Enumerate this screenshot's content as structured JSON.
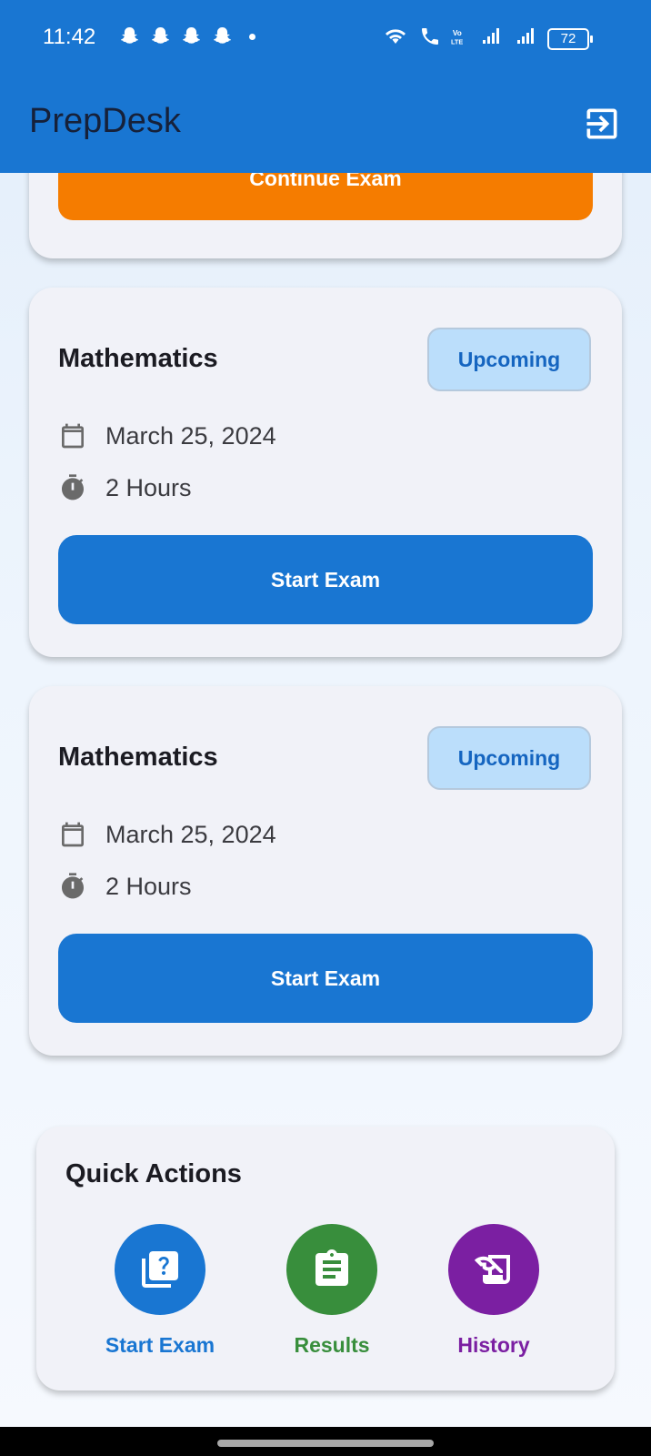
{
  "status_bar": {
    "time": "11:42",
    "battery": "72",
    "icons": [
      "snapchat-icon",
      "snapchat-icon",
      "snapchat-icon",
      "snapchat-icon",
      "dot-icon",
      "wifi-icon",
      "wifi-calling-icon",
      "volte-icon",
      "signal-icon",
      "signal-icon",
      "battery-icon"
    ]
  },
  "app_bar": {
    "title": "PrepDesk",
    "action_icon": "logout-icon"
  },
  "top_card": {
    "button_label": "Continue Exam",
    "button_color": "#f57c00"
  },
  "exams": [
    {
      "subject": "Mathematics",
      "status": "Upcoming",
      "date": "March 25, 2024",
      "duration": "2 Hours",
      "button_label": "Start Exam"
    },
    {
      "subject": "Mathematics",
      "status": "Upcoming",
      "date": "March 25, 2024",
      "duration": "2 Hours",
      "button_label": "Start Exam"
    }
  ],
  "quick_actions": {
    "title": "Quick Actions",
    "items": [
      {
        "label": "Start Exam",
        "icon": "quiz-icon",
        "color": "#1976d2"
      },
      {
        "label": "Results",
        "icon": "assignment-icon",
        "color": "#388e3c"
      },
      {
        "label": "History",
        "icon": "history-edu-icon",
        "color": "#7b1fa2"
      }
    ]
  },
  "colors": {
    "primary": "#1976d2",
    "badge_bg": "#bbdefb",
    "badge_text": "#1565c0"
  }
}
